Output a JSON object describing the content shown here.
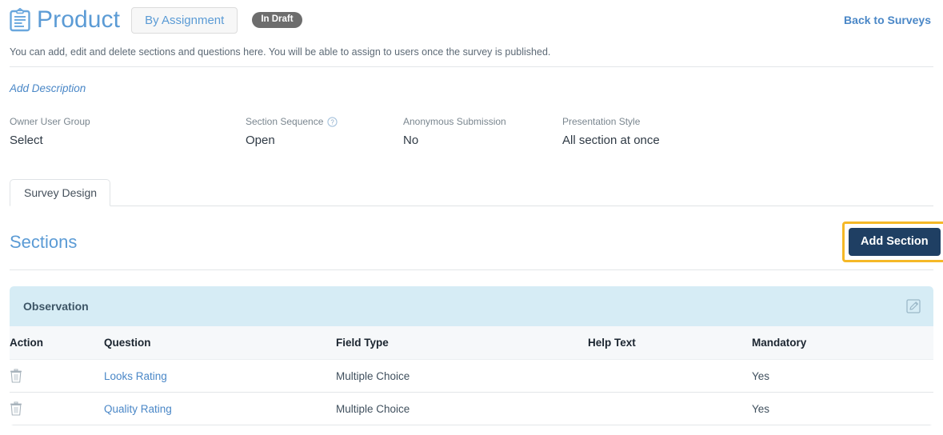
{
  "header": {
    "icon": "clipboard-icon",
    "title": "Product",
    "assignment_button": "By Assignment",
    "status_badge": "In Draft",
    "back_link": "Back to Surveys"
  },
  "intro": {
    "text": "You can add, edit and delete sections and questions here. You will be able to assign to users once the survey is published.",
    "add_description_link": "Add Description"
  },
  "meta": [
    {
      "label": "Owner User Group",
      "value": "Select",
      "help_icon": false
    },
    {
      "label": "Section Sequence",
      "value": "Open",
      "help_icon": true
    },
    {
      "label": "Anonymous Submission",
      "value": "No",
      "help_icon": false
    },
    {
      "label": "Presentation Style",
      "value": "All section at once",
      "help_icon": false
    }
  ],
  "tabs": [
    {
      "label": "Survey Design",
      "active": true
    }
  ],
  "sections_panel": {
    "heading": "Sections",
    "add_section_button": "Add Section"
  },
  "section": {
    "name": "Observation",
    "edit_icon": "edit-pencil-square-icon"
  },
  "table": {
    "columns": [
      "Action",
      "Question",
      "Field Type",
      "Help Text",
      "Mandatory"
    ],
    "rows": [
      {
        "action_icon": "trash-icon",
        "question": "Looks Rating",
        "field_type": "Multiple Choice",
        "help_text": "",
        "mandatory": "Yes"
      },
      {
        "action_icon": "trash-icon",
        "question": "Quality Rating",
        "field_type": "Multiple Choice",
        "help_text": "",
        "mandatory": "Yes"
      }
    ]
  },
  "colors": {
    "accent_blue": "#5b9bd5",
    "link_blue": "#4a87c7",
    "button_navy": "#1f3f63",
    "focus_yellow": "#f5b827",
    "section_bar": "#d6ecf5",
    "badge_gray": "#6d6d6d"
  }
}
